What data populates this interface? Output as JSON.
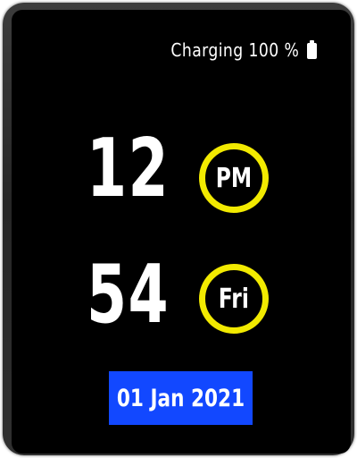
{
  "status": {
    "text": "Charging 100 %",
    "battery_icon": "battery-full-icon"
  },
  "time": {
    "hour": "12",
    "minute": "54",
    "ampm": "PM",
    "day": "Fri"
  },
  "date": {
    "text": "01 Jan 2021"
  },
  "colors": {
    "background": "#000000",
    "ring": "#f2ea00",
    "date_bg": "#1248ff",
    "text": "#ffffff"
  }
}
